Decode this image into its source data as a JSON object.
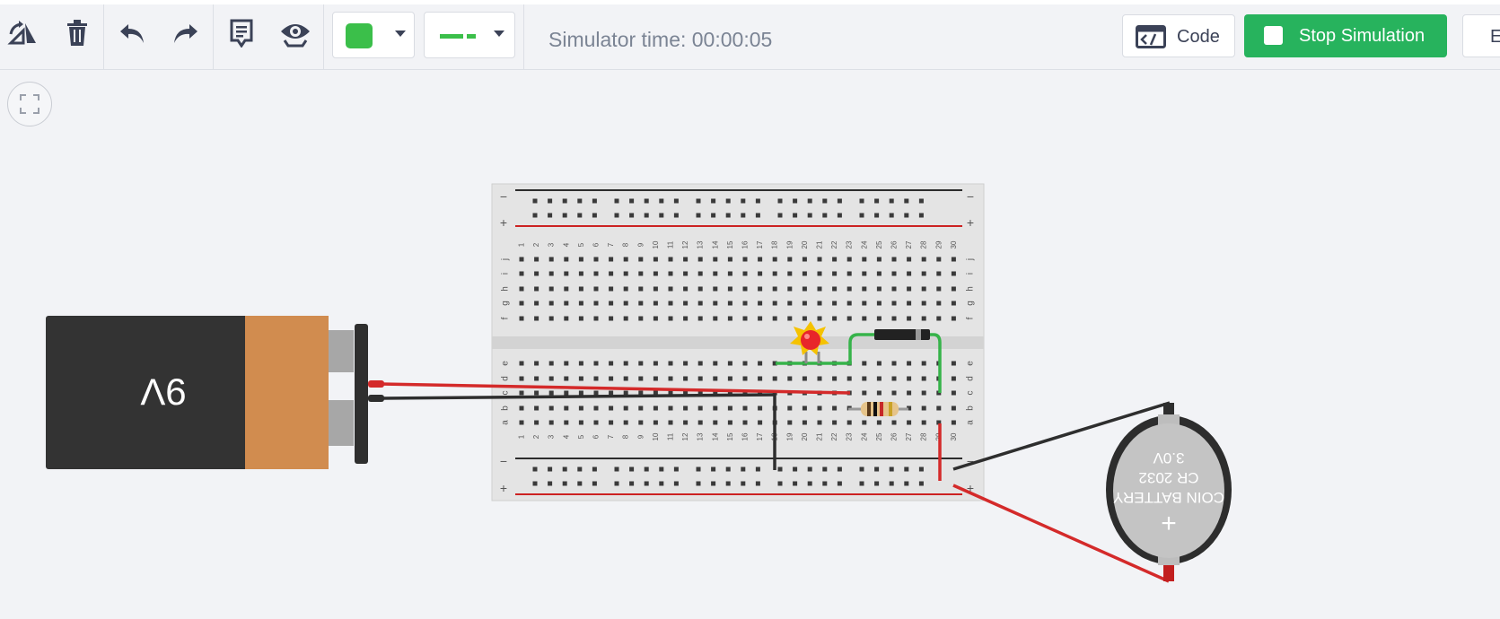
{
  "toolbar": {
    "tools": [
      {
        "name": "rotate-icon"
      },
      {
        "name": "delete-icon"
      },
      {
        "name": "undo-icon"
      },
      {
        "name": "redo-icon"
      },
      {
        "name": "notes-icon"
      },
      {
        "name": "visibility-icon"
      }
    ],
    "wire_color": "#3bbf4a",
    "wire_style_color": "#3bbf4a",
    "simulator_time_label": "Simulator time: 00:00:05",
    "code_label": "Code",
    "stop_label": "Stop Simulation",
    "export_label": "E",
    "accent": "#27b35d"
  },
  "canvas": {
    "battery_9v": {
      "label": "9V"
    },
    "coin_battery": {
      "line1": "COIN BATTERY",
      "line2": "CR 2032",
      "line3": "3.0V",
      "terminal": "+"
    },
    "breadboard": {
      "columns": [
        "1",
        "2",
        "3",
        "4",
        "5",
        "6",
        "7",
        "8",
        "9",
        "10",
        "11",
        "12",
        "13",
        "14",
        "15",
        "16",
        "17",
        "18",
        "19",
        "20",
        "21",
        "22",
        "23",
        "24",
        "25",
        "26",
        "27",
        "28",
        "29",
        "30"
      ],
      "rows_top": [
        "j",
        "i",
        "h",
        "g",
        "f"
      ],
      "rows_bottom": [
        "e",
        "d",
        "c",
        "b",
        "a"
      ],
      "rail_minus": "−",
      "rail_plus": "+"
    },
    "colors": {
      "wire_red": "#d42a2a",
      "wire_black": "#2e2e2e",
      "wire_green": "#36b34a",
      "led": "#e8262a"
    }
  }
}
